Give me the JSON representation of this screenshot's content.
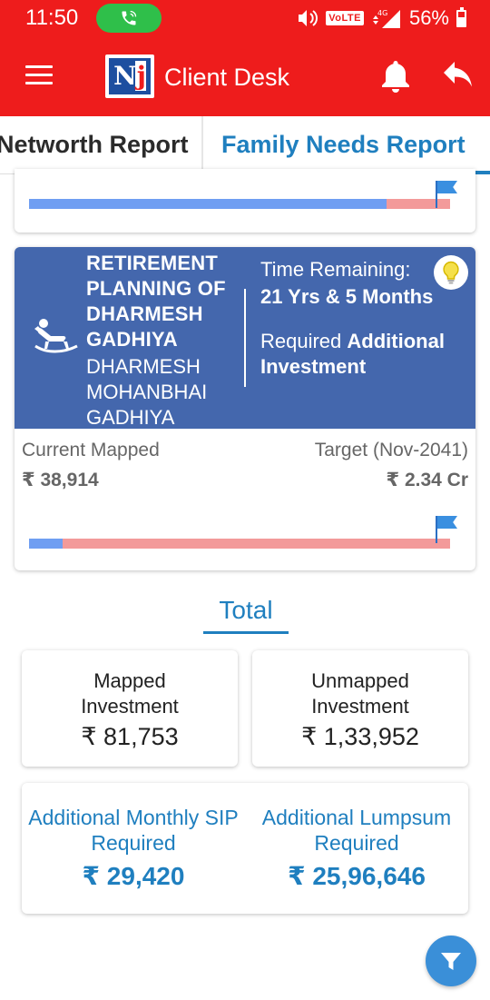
{
  "status_bar": {
    "time": "11:50",
    "network": "VoLTE",
    "signal_label": "4G",
    "battery": "56%"
  },
  "app_bar": {
    "title": "Client Desk",
    "brand_color": "#ee1c1c"
  },
  "tabs": [
    {
      "label": "Networth Report",
      "active": false
    },
    {
      "label": "Family Needs Report",
      "active": true
    }
  ],
  "goal_card_previous": {
    "progress_fraction": 0.85
  },
  "goal_card": {
    "title": "RETIREMENT PLANNING OF DHARMESH GADHIYA",
    "member_name": "DHARMESH MOHANBHAI GADHIYA",
    "time_remaining_label": "Time Remaining:",
    "time_remaining_value": "21 Yrs & 5 Months",
    "required_prefix": "Required",
    "required_emphasis": "Additional Investment",
    "current_mapped_label": "Current Mapped",
    "current_mapped_value": "₹ 38,914",
    "target_label": "Target (Nov-2041)",
    "target_value": "₹ 2.34 Cr",
    "progress_fraction": 0.08,
    "header_color": "#4467ad"
  },
  "totals": {
    "title": "Total",
    "mapped_label": "Mapped Investment",
    "mapped_value": "₹ 81,753",
    "unmapped_label": "Unmapped Investment",
    "unmapped_value": "₹ 1,33,952",
    "sip_label": "Additional Monthly SIP Required",
    "sip_value": "₹ 29,420",
    "lumpsum_label": "Additional Lumpsum Required",
    "lumpsum_value": "₹ 25,96,646",
    "accent_color": "#1f7fbf"
  }
}
